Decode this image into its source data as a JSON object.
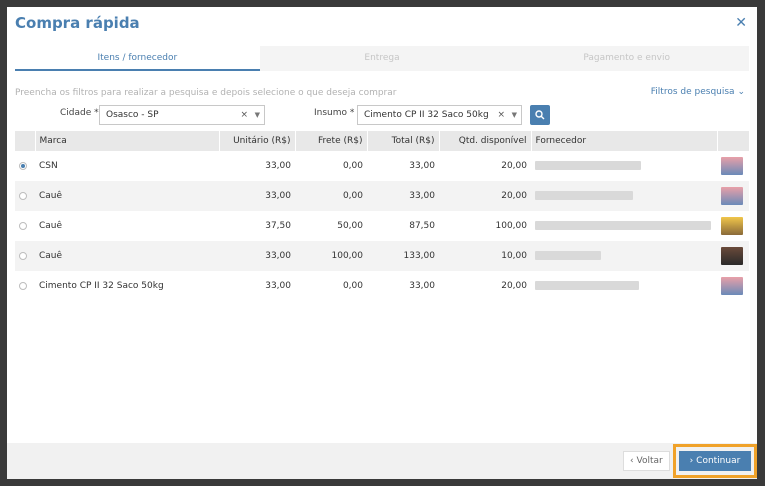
{
  "dialog": {
    "title": "Compra rápida",
    "close_icon": "close-icon"
  },
  "tabs": [
    {
      "label": "Itens / fornecedor",
      "active": true
    },
    {
      "label": "Entrega",
      "active": false
    },
    {
      "label": "Pagamento e envio",
      "active": false
    }
  ],
  "filters": {
    "hint": "Preencha os filtros para realizar a pesquisa e depois selecione o que deseja comprar",
    "toggle_label": "Filtros de pesquisa",
    "city_label": "Cidade *",
    "city_value": "Osasco - SP",
    "input_label": "Insumo *",
    "input_value": "Cimento CP II 32 Saco 50kg",
    "clear_glyph": "×",
    "search_icon": "search-icon"
  },
  "table": {
    "headers": [
      "Marca",
      "Unitário (R$)",
      "Frete (R$)",
      "Total (R$)",
      "Qtd. disponível",
      "Fornecedor"
    ],
    "rows": [
      {
        "marca": "CSN",
        "unitario": "33,00",
        "frete": "0,00",
        "total": "33,00",
        "qtd": "20,00",
        "selected": true
      },
      {
        "marca": "Cauê",
        "unitario": "33,00",
        "frete": "0,00",
        "total": "33,00",
        "qtd": "20,00",
        "selected": false
      },
      {
        "marca": "Cauê",
        "unitario": "37,50",
        "frete": "50,00",
        "total": "87,50",
        "qtd": "100,00",
        "selected": false
      },
      {
        "marca": "Cauê",
        "unitario": "33,00",
        "frete": "100,00",
        "total": "133,00",
        "qtd": "10,00",
        "selected": false
      },
      {
        "marca": "Cimento CP II 32 Saco 50kg",
        "unitario": "33,00",
        "frete": "0,00",
        "total": "33,00",
        "qtd": "20,00",
        "selected": false
      }
    ]
  },
  "footer": {
    "back_label": "Voltar",
    "continue_label": "Continuar"
  },
  "colors": {
    "accent": "#4a7fb0",
    "highlight": "#f0a22a"
  }
}
